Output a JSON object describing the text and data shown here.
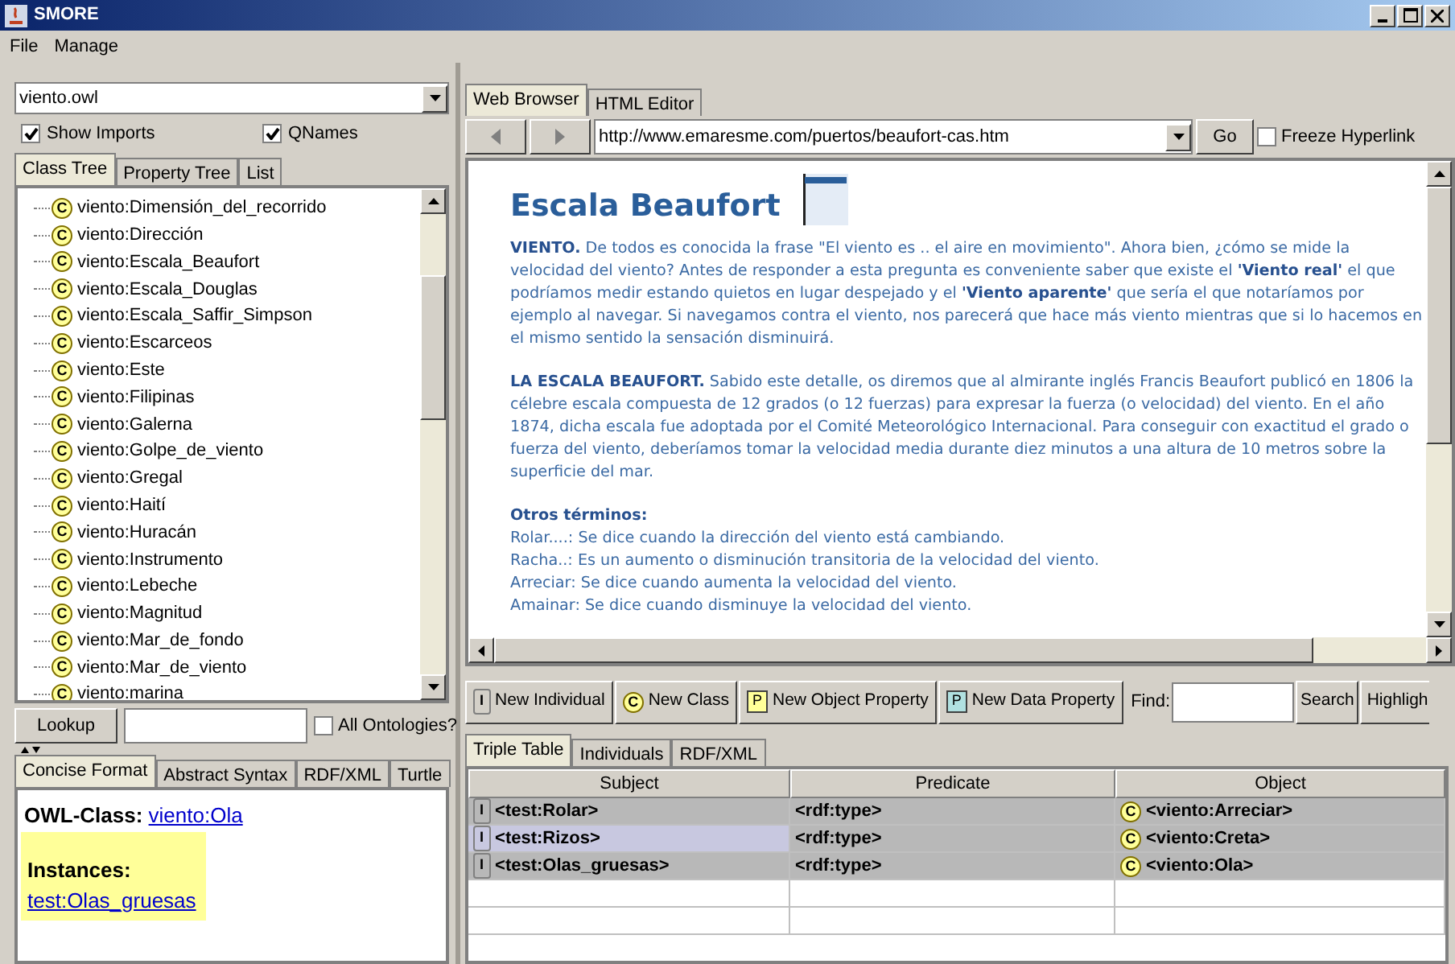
{
  "window": {
    "title": "SMORE"
  },
  "menu": [
    "File",
    "Manage"
  ],
  "left": {
    "ontology": {
      "value": "viento.owl"
    },
    "options": [
      {
        "label": "Show Imports",
        "checked": true
      },
      {
        "label": "QNames",
        "checked": true
      }
    ],
    "tabs": [
      {
        "label": "Class Tree",
        "selected": true
      },
      {
        "label": "Property Tree",
        "selected": false
      },
      {
        "label": "List",
        "selected": false
      }
    ],
    "tree": {
      "items": [
        {
          "label": "viento:Dimensión_del_recorrido",
          "badge": "C"
        },
        {
          "label": "viento:Dirección",
          "badge": "C"
        },
        {
          "label": "viento:Escala_Beaufort",
          "badge": "C"
        },
        {
          "label": "viento:Escala_Douglas",
          "badge": "C"
        },
        {
          "label": "viento:Escala_Saffir_Simpson",
          "badge": "C"
        },
        {
          "label": "viento:Escarceos",
          "badge": "C"
        },
        {
          "label": "viento:Este",
          "badge": "C"
        },
        {
          "label": "viento:Filipinas",
          "badge": "C"
        },
        {
          "label": "viento:Galerna",
          "badge": "C"
        },
        {
          "label": "viento:Golpe_de_viento",
          "badge": "C"
        },
        {
          "label": "viento:Gregal",
          "badge": "C"
        },
        {
          "label": "viento:Haití",
          "badge": "C"
        },
        {
          "label": "viento:Huracán",
          "badge": "C"
        },
        {
          "label": "viento:Instrumento",
          "badge": "C"
        },
        {
          "label": "viento:Lebeche",
          "badge": "C"
        },
        {
          "label": "viento:Magnitud",
          "badge": "C"
        },
        {
          "label": "viento:Mar_de_fondo",
          "badge": "C"
        },
        {
          "label": "viento:Mar_de_viento",
          "badge": "C"
        },
        {
          "label": "viento:marina",
          "badge": "C"
        }
      ]
    },
    "lookup": {
      "button": "Lookup",
      "all_ontologies": {
        "label": "All Ontologies?",
        "checked": false
      }
    },
    "detail_tabs": [
      {
        "label": "Concise Format",
        "selected": true
      },
      {
        "label": "Abstract Syntax",
        "selected": false
      },
      {
        "label": "RDF/XML",
        "selected": false
      },
      {
        "label": "Turtle",
        "selected": false
      }
    ],
    "concise": {
      "class_label": "OWL-Class:",
      "class_link": "viento:Ola",
      "instances_label": "Instances:",
      "instance_link": "test:Olas_gruesas"
    }
  },
  "right": {
    "tabs": [
      {
        "label": "Web Browser",
        "selected": true
      },
      {
        "label": "HTML Editor",
        "selected": false
      }
    ],
    "url": "http://www.emaresme.com/puertos/beaufort-cas.htm",
    "go": "Go",
    "freeze": {
      "label": "Freeze Hyperlink",
      "checked": false
    },
    "page": {
      "title": "Escala Beaufort",
      "paragraphs": [
        "**VIENTO.** De todos es conocida la frase \"El viento es .. el aire en movimiento\". Ahora bien, ¿cómo se mide la velocidad del viento? Antes de responder a esta pregunta es conveniente saber que existe el **'Viento real'** el que podríamos medir estando quietos en lugar despejado y el **'Viento aparente'** que sería el que notaríamos por ejemplo al navegar. Si navegamos contra el viento, nos parecerá que hace más viento mientras que si lo hacemos en el mismo sentido la sensación disminuirá.",
        "**LA ESCALA BEAUFORT.** Sabido este detalle, os diremos que al almirante inglés Francis Beaufort publicó en 1806 la célebre escala compuesta de 12 grados (o 12 fuerzas) para expresar la fuerza (o velocidad) del viento. En el año 1874, dicha escala fue adoptada por el Comité Meteorológico Internacional. Para conseguir con exactitud el grado o fuerza del viento, deberíamos tomar la velocidad media durante diez minutos a una altura de 10 metros sobre la superficie del mar."
      ],
      "terms_heading": "Otros términos:",
      "terms": [
        "Rolar....: Se dice cuando la dirección del viento está cambiando.",
        "Racha..: Es un aumento o disminución transitoria de la velocidad del viento.",
        "Arreciar: Se dice cuando aumenta la velocidad del viento.",
        "Amainar: Se dice cuando disminuye la velocidad del viento."
      ]
    },
    "toolbar": [
      {
        "label": "New Individual",
        "kind": "individual",
        "badge": "I"
      },
      {
        "label": "New Class",
        "kind": "class",
        "badge": "C"
      },
      {
        "label": "New Object Property",
        "kind": "object_property",
        "badge": "P"
      },
      {
        "label": "New Data Property",
        "kind": "data_property",
        "badge": "P"
      }
    ],
    "find": {
      "label": "Find:",
      "search": "Search",
      "highlight": "Highligh"
    },
    "bottom_tabs": [
      {
        "label": "Triple Table",
        "selected": true
      },
      {
        "label": "Individuals",
        "selected": false
      },
      {
        "label": "RDF/XML",
        "selected": false
      }
    ],
    "table": {
      "columns": [
        "Subject",
        "Predicate",
        "Object"
      ],
      "rows": [
        {
          "subject": "<test:Rolar>",
          "subject_badge": "I",
          "predicate": "<rdf:type>",
          "object": "<viento:Arreciar>",
          "object_badge": "C",
          "selected": true,
          "focused": false
        },
        {
          "subject": "<test:Rizos>",
          "subject_badge": "I",
          "predicate": "<rdf:type>",
          "object": "<viento:Creta>",
          "object_badge": "C",
          "selected": true,
          "focused": true
        },
        {
          "subject": "<test:Olas_gruesas>",
          "subject_badge": "I",
          "predicate": "<rdf:type>",
          "object": "<viento:Ola>",
          "object_badge": "C",
          "selected": true,
          "focused": false
        }
      ]
    }
  }
}
